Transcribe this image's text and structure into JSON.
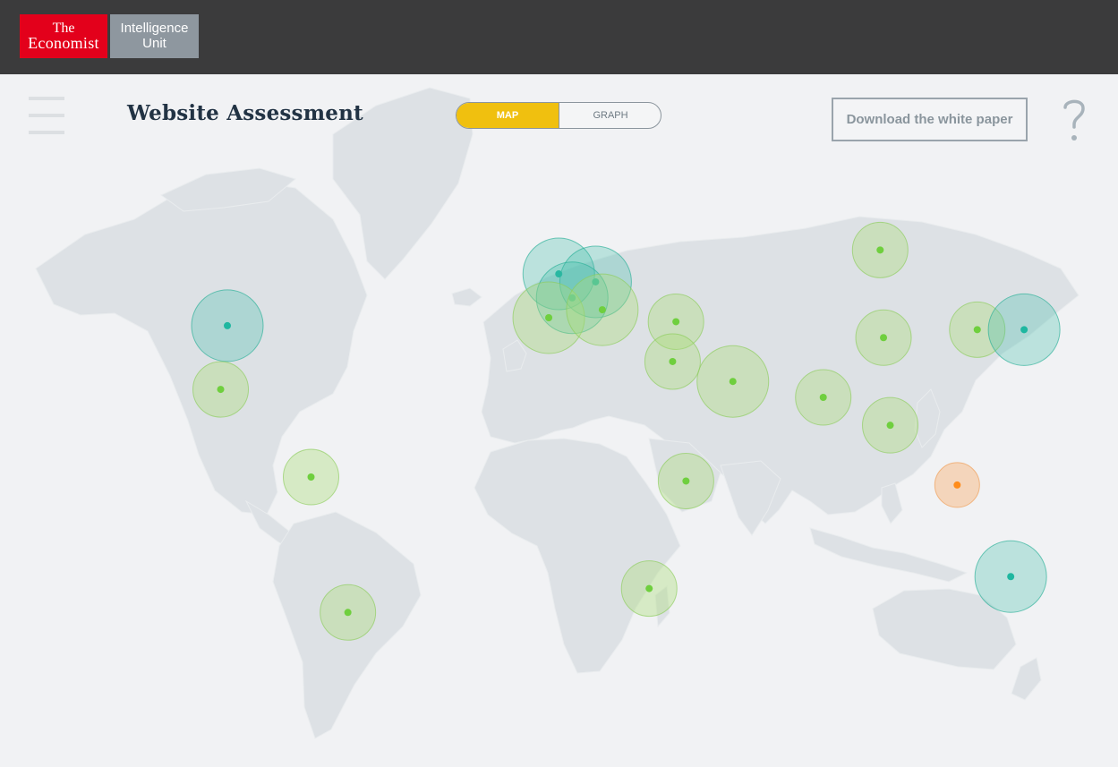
{
  "brand": {
    "logo_line1": "The",
    "logo_line2": "Economist",
    "unit_line1": "Intelligence",
    "unit_line2": "Unit",
    "red": "#e3001b"
  },
  "header": {
    "title": "Website Assessment",
    "view_toggle": {
      "map_label": "MAP",
      "graph_label": "GRAPH",
      "active": "MAP"
    },
    "download_label": "Download the white paper",
    "help_icon": "question-mark-icon",
    "menu_icon": "hamburger-icon"
  },
  "colors": {
    "teal": "#1fb7a0",
    "green": "#6fcf3e",
    "orange": "#ff8c1a",
    "toggle_active": "#f0c00f",
    "land": "#dde1e5"
  },
  "map_markers": [
    {
      "region": "North America",
      "category": "teal",
      "lon": -100,
      "lat": 38,
      "size": "large"
    },
    {
      "region": "Central America",
      "category": "green",
      "lon": -102,
      "lat": 22,
      "size": "medium"
    },
    {
      "region": "South America North",
      "category": "green",
      "lon": -75,
      "lat": 0,
      "size": "medium"
    },
    {
      "region": "South America South",
      "category": "green",
      "lon": -64,
      "lat": -34,
      "size": "medium"
    },
    {
      "region": "Western Europe",
      "category": "teal",
      "lon": -1,
      "lat": 51,
      "size": "large"
    },
    {
      "region": "Central Europe",
      "category": "teal",
      "lon": 10,
      "lat": 49,
      "size": "large"
    },
    {
      "region": "Western Europe South",
      "category": "teal",
      "lon": 3,
      "lat": 45,
      "size": "large"
    },
    {
      "region": "Iberia",
      "category": "green",
      "lon": -4,
      "lat": 40,
      "size": "large"
    },
    {
      "region": "Italy",
      "category": "green",
      "lon": 12,
      "lat": 42,
      "size": "large"
    },
    {
      "region": "Turkey",
      "category": "green",
      "lon": 34,
      "lat": 39,
      "size": "medium"
    },
    {
      "region": "Middle East",
      "category": "green",
      "lon": 33,
      "lat": 29,
      "size": "medium"
    },
    {
      "region": "Arabia",
      "category": "green",
      "lon": 51,
      "lat": 24,
      "size": "large"
    },
    {
      "region": "South Asia",
      "category": "green",
      "lon": 78,
      "lat": 20,
      "size": "medium"
    },
    {
      "region": "Russia",
      "category": "green",
      "lon": 95,
      "lat": 57,
      "size": "medium"
    },
    {
      "region": "China",
      "category": "green",
      "lon": 96,
      "lat": 35,
      "size": "medium"
    },
    {
      "region": "Korea",
      "category": "green",
      "lon": 124,
      "lat": 37,
      "size": "medium"
    },
    {
      "region": "Japan",
      "category": "teal",
      "lon": 138,
      "lat": 37,
      "size": "large"
    },
    {
      "region": "Southeast Asia",
      "category": "green",
      "lon": 98,
      "lat": 13,
      "size": "medium"
    },
    {
      "region": "Indonesia",
      "category": "orange",
      "lon": 118,
      "lat": -2,
      "size": "small"
    },
    {
      "region": "East Africa",
      "category": "green",
      "lon": 37,
      "lat": -1,
      "size": "medium"
    },
    {
      "region": "Southern Africa",
      "category": "green",
      "lon": 26,
      "lat": -28,
      "size": "medium"
    },
    {
      "region": "Australia",
      "category": "teal",
      "lon": 134,
      "lat": -25,
      "size": "large"
    }
  ]
}
